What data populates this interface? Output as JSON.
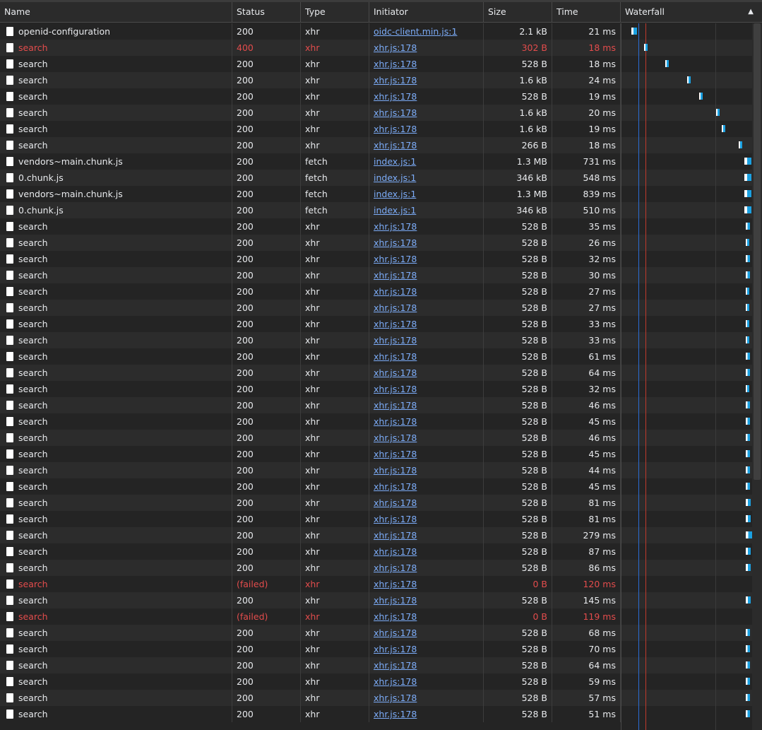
{
  "columns": {
    "name": "Name",
    "status": "Status",
    "type": "Type",
    "initiator": "Initiator",
    "size": "Size",
    "time": "Time",
    "waterfall": "Waterfall"
  },
  "sort_icon": "triangle-up-icon",
  "colors": {
    "background": "#242424",
    "row_alt": "#2c2c2c",
    "error_text": "#e34c4c",
    "link": "#7cacf8",
    "dom_content_loaded_line": "#2b6cd4",
    "load_line": "#c0392b",
    "waterfall_bar": "#1ba1e2",
    "waterfall_waiting": "#ffffff"
  },
  "requests": [
    {
      "name": "openid-configuration",
      "status": "200",
      "type": "xhr",
      "initiator": "oidc-client.min.js:1",
      "size": "2.1 kB",
      "time": "21 ms",
      "error": false
    },
    {
      "name": "search",
      "status": "400",
      "type": "xhr",
      "initiator": "xhr.js:178",
      "size": "302 B",
      "time": "18 ms",
      "error": true
    },
    {
      "name": "search",
      "status": "200",
      "type": "xhr",
      "initiator": "xhr.js:178",
      "size": "528 B",
      "time": "18 ms",
      "error": false
    },
    {
      "name": "search",
      "status": "200",
      "type": "xhr",
      "initiator": "xhr.js:178",
      "size": "1.6 kB",
      "time": "24 ms",
      "error": false
    },
    {
      "name": "search",
      "status": "200",
      "type": "xhr",
      "initiator": "xhr.js:178",
      "size": "528 B",
      "time": "19 ms",
      "error": false
    },
    {
      "name": "search",
      "status": "200",
      "type": "xhr",
      "initiator": "xhr.js:178",
      "size": "1.6 kB",
      "time": "20 ms",
      "error": false
    },
    {
      "name": "search",
      "status": "200",
      "type": "xhr",
      "initiator": "xhr.js:178",
      "size": "1.6 kB",
      "time": "19 ms",
      "error": false
    },
    {
      "name": "search",
      "status": "200",
      "type": "xhr",
      "initiator": "xhr.js:178",
      "size": "266 B",
      "time": "18 ms",
      "error": false
    },
    {
      "name": "vendors~main.chunk.js",
      "status": "200",
      "type": "fetch",
      "initiator": "index.js:1",
      "size": "1.3 MB",
      "time": "731 ms",
      "error": false
    },
    {
      "name": "0.chunk.js",
      "status": "200",
      "type": "fetch",
      "initiator": "index.js:1",
      "size": "346 kB",
      "time": "548 ms",
      "error": false
    },
    {
      "name": "vendors~main.chunk.js",
      "status": "200",
      "type": "fetch",
      "initiator": "index.js:1",
      "size": "1.3 MB",
      "time": "839 ms",
      "error": false
    },
    {
      "name": "0.chunk.js",
      "status": "200",
      "type": "fetch",
      "initiator": "index.js:1",
      "size": "346 kB",
      "time": "510 ms",
      "error": false
    },
    {
      "name": "search",
      "status": "200",
      "type": "xhr",
      "initiator": "xhr.js:178",
      "size": "528 B",
      "time": "35 ms",
      "error": false
    },
    {
      "name": "search",
      "status": "200",
      "type": "xhr",
      "initiator": "xhr.js:178",
      "size": "528 B",
      "time": "26 ms",
      "error": false
    },
    {
      "name": "search",
      "status": "200",
      "type": "xhr",
      "initiator": "xhr.js:178",
      "size": "528 B",
      "time": "32 ms",
      "error": false
    },
    {
      "name": "search",
      "status": "200",
      "type": "xhr",
      "initiator": "xhr.js:178",
      "size": "528 B",
      "time": "30 ms",
      "error": false
    },
    {
      "name": "search",
      "status": "200",
      "type": "xhr",
      "initiator": "xhr.js:178",
      "size": "528 B",
      "time": "27 ms",
      "error": false
    },
    {
      "name": "search",
      "status": "200",
      "type": "xhr",
      "initiator": "xhr.js:178",
      "size": "528 B",
      "time": "27 ms",
      "error": false
    },
    {
      "name": "search",
      "status": "200",
      "type": "xhr",
      "initiator": "xhr.js:178",
      "size": "528 B",
      "time": "33 ms",
      "error": false
    },
    {
      "name": "search",
      "status": "200",
      "type": "xhr",
      "initiator": "xhr.js:178",
      "size": "528 B",
      "time": "33 ms",
      "error": false
    },
    {
      "name": "search",
      "status": "200",
      "type": "xhr",
      "initiator": "xhr.js:178",
      "size": "528 B",
      "time": "61 ms",
      "error": false
    },
    {
      "name": "search",
      "status": "200",
      "type": "xhr",
      "initiator": "xhr.js:178",
      "size": "528 B",
      "time": "64 ms",
      "error": false
    },
    {
      "name": "search",
      "status": "200",
      "type": "xhr",
      "initiator": "xhr.js:178",
      "size": "528 B",
      "time": "32 ms",
      "error": false
    },
    {
      "name": "search",
      "status": "200",
      "type": "xhr",
      "initiator": "xhr.js:178",
      "size": "528 B",
      "time": "46 ms",
      "error": false
    },
    {
      "name": "search",
      "status": "200",
      "type": "xhr",
      "initiator": "xhr.js:178",
      "size": "528 B",
      "time": "45 ms",
      "error": false
    },
    {
      "name": "search",
      "status": "200",
      "type": "xhr",
      "initiator": "xhr.js:178",
      "size": "528 B",
      "time": "46 ms",
      "error": false
    },
    {
      "name": "search",
      "status": "200",
      "type": "xhr",
      "initiator": "xhr.js:178",
      "size": "528 B",
      "time": "45 ms",
      "error": false
    },
    {
      "name": "search",
      "status": "200",
      "type": "xhr",
      "initiator": "xhr.js:178",
      "size": "528 B",
      "time": "44 ms",
      "error": false
    },
    {
      "name": "search",
      "status": "200",
      "type": "xhr",
      "initiator": "xhr.js:178",
      "size": "528 B",
      "time": "45 ms",
      "error": false
    },
    {
      "name": "search",
      "status": "200",
      "type": "xhr",
      "initiator": "xhr.js:178",
      "size": "528 B",
      "time": "81 ms",
      "error": false
    },
    {
      "name": "search",
      "status": "200",
      "type": "xhr",
      "initiator": "xhr.js:178",
      "size": "528 B",
      "time": "81 ms",
      "error": false
    },
    {
      "name": "search",
      "status": "200",
      "type": "xhr",
      "initiator": "xhr.js:178",
      "size": "528 B",
      "time": "279 ms",
      "error": false
    },
    {
      "name": "search",
      "status": "200",
      "type": "xhr",
      "initiator": "xhr.js:178",
      "size": "528 B",
      "time": "87 ms",
      "error": false
    },
    {
      "name": "search",
      "status": "200",
      "type": "xhr",
      "initiator": "xhr.js:178",
      "size": "528 B",
      "time": "86 ms",
      "error": false
    },
    {
      "name": "search",
      "status": "(failed)",
      "type": "xhr",
      "initiator": "xhr.js:178",
      "size": "0 B",
      "time": "120 ms",
      "error": true
    },
    {
      "name": "search",
      "status": "200",
      "type": "xhr",
      "initiator": "xhr.js:178",
      "size": "528 B",
      "time": "145 ms",
      "error": false
    },
    {
      "name": "search",
      "status": "(failed)",
      "type": "xhr",
      "initiator": "xhr.js:178",
      "size": "0 B",
      "time": "119 ms",
      "error": true
    },
    {
      "name": "search",
      "status": "200",
      "type": "xhr",
      "initiator": "xhr.js:178",
      "size": "528 B",
      "time": "68 ms",
      "error": false
    },
    {
      "name": "search",
      "status": "200",
      "type": "xhr",
      "initiator": "xhr.js:178",
      "size": "528 B",
      "time": "70 ms",
      "error": false
    },
    {
      "name": "search",
      "status": "200",
      "type": "xhr",
      "initiator": "xhr.js:178",
      "size": "528 B",
      "time": "64 ms",
      "error": false
    },
    {
      "name": "search",
      "status": "200",
      "type": "xhr",
      "initiator": "xhr.js:178",
      "size": "528 B",
      "time": "59 ms",
      "error": false
    },
    {
      "name": "search",
      "status": "200",
      "type": "xhr",
      "initiator": "xhr.js:178",
      "size": "528 B",
      "time": "57 ms",
      "error": false
    },
    {
      "name": "search",
      "status": "200",
      "type": "xhr",
      "initiator": "xhr.js:178",
      "size": "528 B",
      "time": "51 ms",
      "error": false
    }
  ]
}
